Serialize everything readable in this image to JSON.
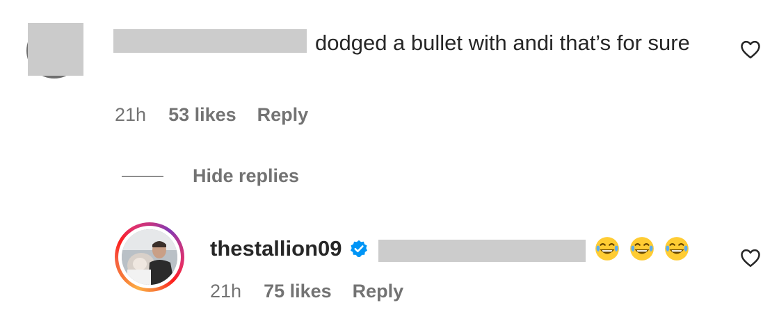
{
  "comments": [
    {
      "text_visible": "dodged a bullet with andi that’s for sure",
      "time": "21h",
      "likes": "53 likes",
      "reply_label": "Reply"
    }
  ],
  "hide_replies_label": "Hide replies",
  "reply": {
    "username": "thestallion09",
    "verified": true,
    "emojis": [
      "face-with-tears-of-joy",
      "face-with-tears-of-joy",
      "face-with-tears-of-joy"
    ],
    "time": "21h",
    "likes": "75 likes",
    "reply_label": "Reply"
  },
  "icons": {
    "like": "heart-outline-icon",
    "verified": "verified-badge-icon"
  },
  "colors": {
    "text_primary": "#262626",
    "text_secondary": "#737373",
    "verified_blue": "#0095f6",
    "redaction_gray": "#cccccc"
  }
}
